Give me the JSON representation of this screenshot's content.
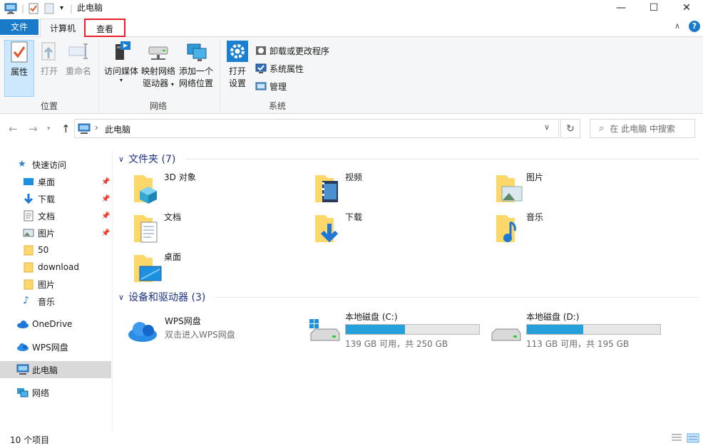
{
  "window": {
    "title": "此电脑"
  },
  "ribbon": {
    "tabs": [
      "文件",
      "计算机",
      "查看"
    ],
    "groups": {
      "location": {
        "label": "位置",
        "buttons": [
          "属性",
          "打开",
          "重命名"
        ]
      },
      "network": {
        "label": "网络",
        "buttons": [
          {
            "line1": "访问媒体",
            "line2": ""
          },
          {
            "line1": "映射网络",
            "line2": "驱动器"
          },
          {
            "line1": "添加一个",
            "line2": "网络位置"
          }
        ]
      },
      "system": {
        "label": "系统",
        "big": {
          "line1": "打开",
          "line2": "设置"
        },
        "small": [
          "卸载或更改程序",
          "系统属性",
          "管理"
        ]
      }
    }
  },
  "address": {
    "path": "此电脑",
    "search_placeholder": "在 此电脑 中搜索"
  },
  "sidebar": {
    "quick_access": "快速访问",
    "items": [
      {
        "label": "桌面",
        "pinned": true,
        "icon": "desktop-icon"
      },
      {
        "label": "下载",
        "pinned": true,
        "icon": "download-icon"
      },
      {
        "label": "文档",
        "pinned": true,
        "icon": "document-icon"
      },
      {
        "label": "图片",
        "pinned": true,
        "icon": "picture-icon"
      },
      {
        "label": "50",
        "pinned": false,
        "icon": "folder-icon"
      },
      {
        "label": "download",
        "pinned": false,
        "icon": "folder-icon"
      },
      {
        "label": "图片",
        "pinned": false,
        "icon": "folder-icon"
      },
      {
        "label": "音乐",
        "pinned": false,
        "icon": "music-icon"
      }
    ],
    "onedrive": "OneDrive",
    "wps": "WPS网盘",
    "this_pc": "此电脑",
    "network": "网络"
  },
  "content": {
    "folders_header": "文件夹 (7)",
    "folders": [
      "3D 对象",
      "视频",
      "图片",
      "文档",
      "下载",
      "音乐",
      "桌面"
    ],
    "devices_header": "设备和驱动器 (3)",
    "wps": {
      "name": "WPS网盘",
      "sub": "双击进入WPS网盘"
    },
    "drives": [
      {
        "name": "本地磁盘 (C:)",
        "sub": "139 GB 可用，共 250 GB",
        "used_fraction": 0.444
      },
      {
        "name": "本地磁盘 (D:)",
        "sub": "113 GB 可用，共 195 GB",
        "used_fraction": 0.42
      }
    ]
  },
  "status": {
    "count": "10 个项目"
  },
  "colors": {
    "accent": "#1979ca",
    "highlight_box": "#e8202a",
    "drive_fill": "#26a0da",
    "section_header": "#1e3287"
  }
}
